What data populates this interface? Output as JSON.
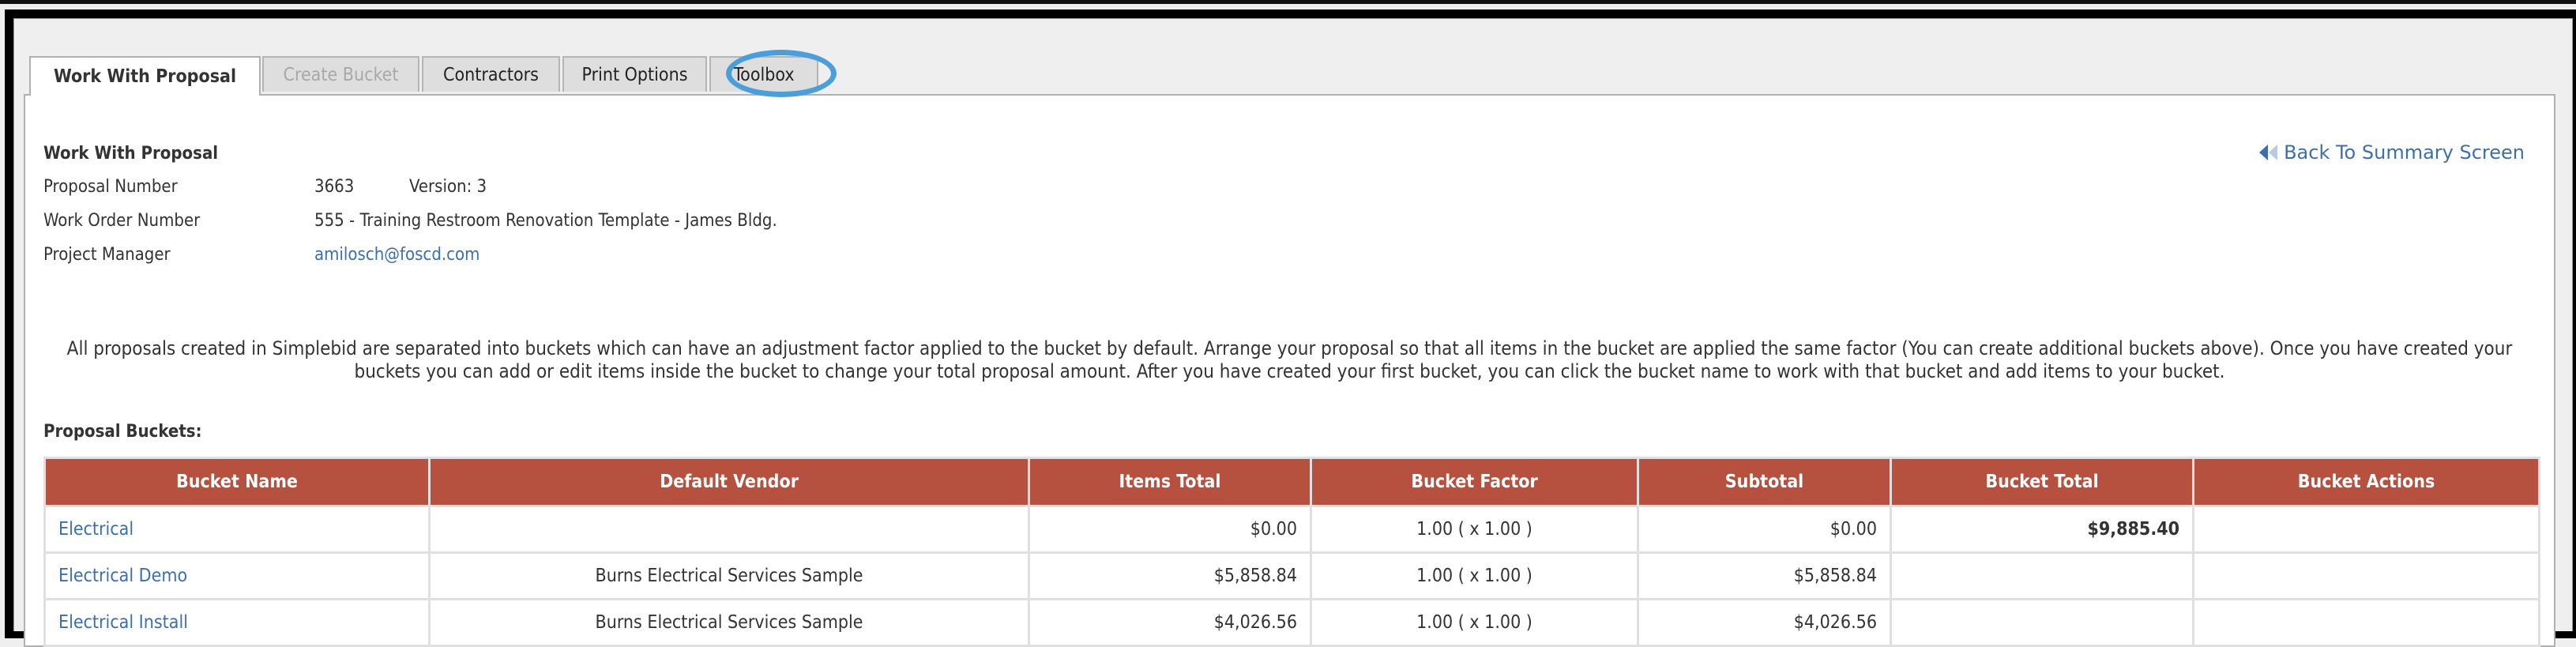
{
  "tabs": [
    {
      "label": "Work With Proposal",
      "state": "active"
    },
    {
      "label": "Create Bucket",
      "state": "disabled"
    },
    {
      "label": "Contractors",
      "state": "normal"
    },
    {
      "label": "Print Options",
      "state": "normal"
    },
    {
      "label": "Toolbox",
      "state": "normal",
      "highlighted": true
    }
  ],
  "annotation": {
    "highlight_color": "#4a9fdb",
    "target": "Toolbox"
  },
  "header": {
    "title": "Work With Proposal",
    "back_link": "Back To Summary Screen",
    "back_icon": "rewind-left-icon"
  },
  "details": {
    "proposal_number_label": "Proposal Number",
    "proposal_number": "3663",
    "version": "Version: 3",
    "work_order_label": "Work Order Number",
    "work_order": "555 - Training Restroom Renovation Template - James Bldg.",
    "project_manager_label": "Project Manager",
    "project_manager": "amilosch@foscd.com"
  },
  "description": "All proposals created in Simplebid are separated into buckets which can have an adjustment factor applied to the bucket by default. Arrange your proposal so that all items in the bucket are applied the same factor (You can create additional buckets above). Once you have created your buckets you can add or edit items inside the bucket to change your total proposal amount. After you have created your first bucket, you can click the bucket name to work with that bucket and add items to your bucket.",
  "buckets_title": "Proposal Buckets:",
  "table": {
    "header_color": "#b5513e",
    "columns": [
      "Bucket Name",
      "Default Vendor",
      "Items Total",
      "Bucket Factor",
      "Subtotal",
      "Bucket Total",
      "Bucket Actions"
    ],
    "rows": [
      {
        "name": "Electrical",
        "indent": false,
        "vendor": "",
        "items_total": "$0.00",
        "factor": "1.00 ( x 1.00 )",
        "subtotal": "$0.00",
        "bucket_total": "$9,885.40",
        "actions": ""
      },
      {
        "name": "Electrical Demo",
        "indent": true,
        "vendor": "Burns Electrical Services Sample",
        "items_total": "$5,858.84",
        "factor": "1.00 ( x 1.00 )",
        "subtotal": "$5,858.84",
        "bucket_total": "",
        "actions": ""
      },
      {
        "name": "Electrical Install",
        "indent": true,
        "vendor": "Burns Electrical Services Sample",
        "items_total": "$4,026.56",
        "factor": "1.00 ( x 1.00 )",
        "subtotal": "$4,026.56",
        "bucket_total": "",
        "actions": ""
      }
    ]
  }
}
